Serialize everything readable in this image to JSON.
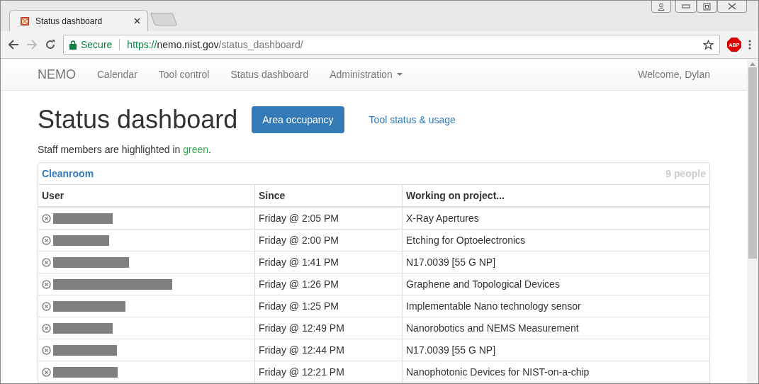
{
  "browser": {
    "tab_title": "Status dashboard",
    "secure_label": "Secure",
    "url_scheme": "https://",
    "url_host": "nemo.nist.gov",
    "url_path": "/status_dashboard/",
    "extension_label": "ABP"
  },
  "navbar": {
    "brand": "NEMO",
    "items": [
      {
        "label": "Calendar",
        "dropdown": false
      },
      {
        "label": "Tool control",
        "dropdown": false
      },
      {
        "label": "Status dashboard",
        "dropdown": false
      },
      {
        "label": "Administration",
        "dropdown": true
      }
    ],
    "welcome": "Welcome, Dylan"
  },
  "page": {
    "title": "Status dashboard",
    "tabs": [
      {
        "label": "Area occupancy",
        "selected": true
      },
      {
        "label": "Tool status & usage",
        "selected": false
      }
    ],
    "note": "Staff members are highlighted in ",
    "note_highlight": "green",
    "note_end": "."
  },
  "area": {
    "name": "Cleanroom",
    "count": "9 people",
    "columns": [
      "User",
      "Since",
      "Working on project..."
    ],
    "rows": [
      {
        "since": "Friday @ 2:05 PM",
        "project": "X-Ray Apertures"
      },
      {
        "since": "Friday @ 2:00 PM",
        "project": "Etching for Optoelectronics"
      },
      {
        "since": "Friday @ 1:41 PM",
        "project": "N17.0039 [55 G NP]"
      },
      {
        "since": "Friday @ 1:26 PM",
        "project": "Graphene and Topological Devices"
      },
      {
        "since": "Friday @ 1:25 PM",
        "project": "Implementable Nano technology sensor"
      },
      {
        "since": "Friday @ 12:49 PM",
        "project": "Nanorobotics and NEMS Measurement"
      },
      {
        "since": "Friday @ 12:44 PM",
        "project": "N17.0039 [55 G NP]"
      },
      {
        "since": "Friday @ 12:21 PM",
        "project": "Nanophotonic Devices for NIST-on-a-chip"
      }
    ]
  }
}
